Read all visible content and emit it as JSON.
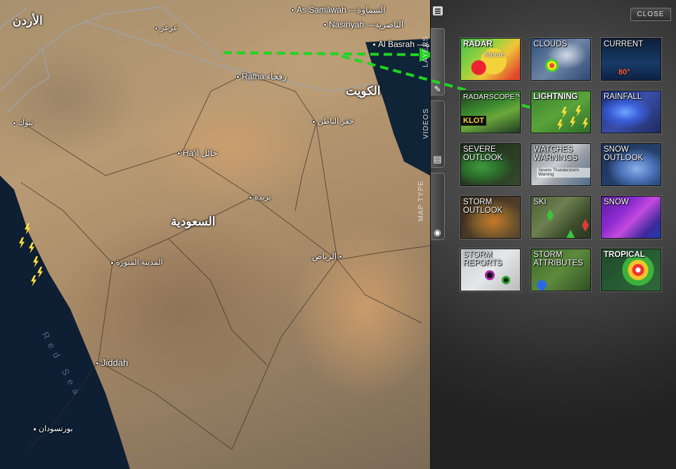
{
  "map": {
    "labels": {
      "jordan": "الأردن",
      "as_samawah": "As Samāwah —السماوة",
      "arar": "عرعر",
      "nasiriyah": "Nasiriyah —الناصرية",
      "al_basrah": "Al Basrah —ة",
      "rafha": "Rafha رفحاء",
      "kuwait": "الكويت",
      "hafar": "حفر الباطن",
      "tabuk": "تبوك",
      "hail": "Ha'il حائل",
      "buraydah": "بريدة",
      "saudi": "السعودية",
      "riyadh": "الرياض",
      "madinah": "المدينة المنورة",
      "jiddah": "Jiddah",
      "port_sudan": "بورتسودان",
      "red_sea": "Red Sea"
    }
  },
  "panel": {
    "close_label": "CLOSE",
    "tabs": [
      {
        "label": "LAYERS"
      },
      {
        "label": "VIDEOS"
      },
      {
        "label": "MAP TYPE"
      }
    ],
    "tiles": [
      {
        "label": "RADAR",
        "extra": "Moore"
      },
      {
        "label": "CLOUDS"
      },
      {
        "label": "CURRENT",
        "extra": "80°"
      },
      {
        "label": "RADARSCOPE™",
        "extra": "KLOT"
      },
      {
        "label": "LIGHTNING"
      },
      {
        "label": "RAINFALL"
      },
      {
        "label": "SEVERE\nOUTLOOK"
      },
      {
        "label": "WATCHES\nWARNINGS",
        "extra": "Severe Thunderstorm Warning"
      },
      {
        "label": "SNOW\nOUTLOOK"
      },
      {
        "label": "STORM\nOUTLOOK"
      },
      {
        "label": "SKI"
      },
      {
        "label": "SNOW"
      },
      {
        "label": "STORM\nREPORTS"
      },
      {
        "label": "STORM\nATTRIBUTES"
      },
      {
        "label": "TROPICAL"
      }
    ]
  },
  "colors": {
    "arrow": "#22d322",
    "bolt": "#ffe23a",
    "panel_bg": "#444444"
  }
}
